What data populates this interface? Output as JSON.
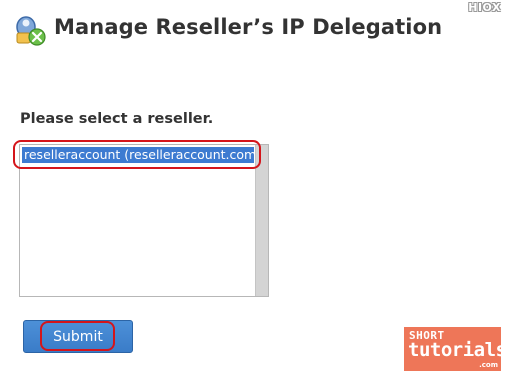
{
  "header": {
    "title": "Manage Reseller’s IP Delegation",
    "brand_mark": "HIOX",
    "icon": "ip-delegation-icon"
  },
  "form": {
    "prompt": "Please select a reseller.",
    "reseller_list": {
      "selected_option": "reselleraccount (reselleraccount.com)"
    },
    "submit_label": "Submit"
  },
  "watermark": {
    "line1": "SHORT",
    "line2": "tutorials",
    "line3": ".com"
  },
  "colors": {
    "selection": "#3d7bd1",
    "button": "#3a7cc8",
    "annotation": "#d4151b",
    "watermark_bg": "#ee7658"
  }
}
